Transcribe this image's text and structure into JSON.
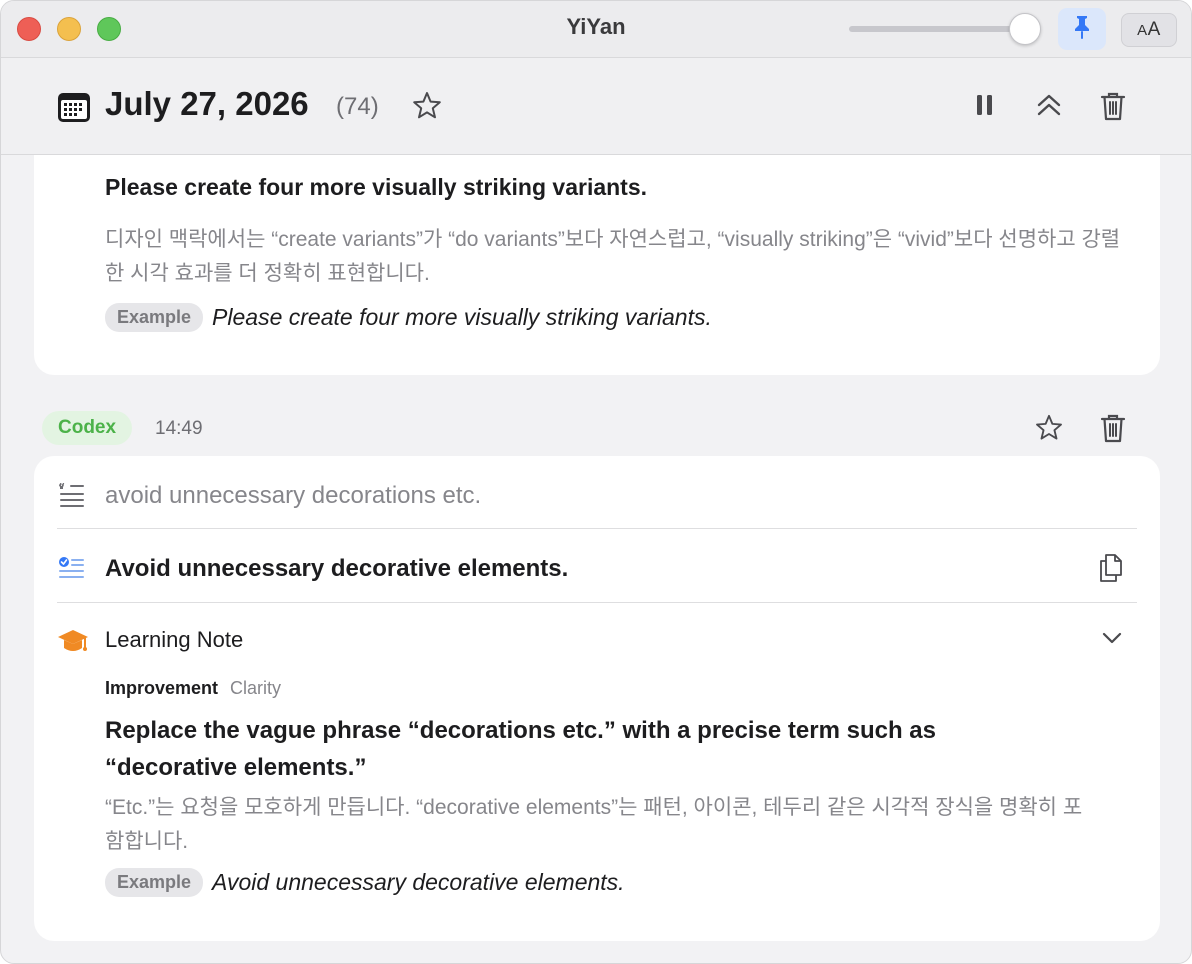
{
  "window": {
    "title": "YiYan"
  },
  "toolbar": {
    "aa_label_big": "A",
    "aa_label_small": "A",
    "slider_value": 0.95
  },
  "header": {
    "date": "July 27, 2026",
    "count": "(74)"
  },
  "entry1": {
    "heading": "Please create four more visually striking variants.",
    "explanation": "디자인 맥락에서는 “create variants”가 “do variants”보다 자연스럽고, “visually striking”은 “vivid”보다 선명하고 강렬한 시각 효과를 더 정확히 표현합니다.",
    "example_badge": "Example",
    "example_text": "Please create four more visually striking variants."
  },
  "entry2": {
    "source_badge": "Codex",
    "time": "14:49",
    "original": "avoid unnecessary decorations etc.",
    "corrected": "Avoid unnecessary decorative elements.",
    "note": {
      "title": "Learning Note",
      "label": "Improvement",
      "label_sub": "Clarity",
      "headline": "Replace the vague phrase “decorations etc.” with a precise term such as “decorative elements.”",
      "explanation": "“Etc.”는 요청을 모호하게 만듭니다. “decorative elements”는 패턴, 아이콘, 테두리 같은 시각적 장식을 명확히 포함합니다.",
      "example_badge": "Example",
      "example_text": "Avoid unnecessary decorative elements."
    }
  },
  "colors": {
    "accent_blue": "#3478f6",
    "codex_green": "#4cb249",
    "note_orange": "#f08a24"
  }
}
